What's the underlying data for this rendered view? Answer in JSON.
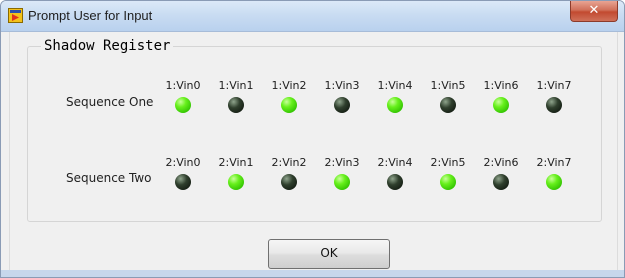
{
  "window": {
    "title": "Prompt User for Input",
    "close_glyph": "✕"
  },
  "group": {
    "title": "Shadow Register"
  },
  "sequences": [
    {
      "label": "Sequence One",
      "leds": [
        {
          "label": "1:Vin0",
          "on": true
        },
        {
          "label": "1:Vin1",
          "on": false
        },
        {
          "label": "1:Vin2",
          "on": true
        },
        {
          "label": "1:Vin3",
          "on": false
        },
        {
          "label": "1:Vin4",
          "on": true
        },
        {
          "label": "1:Vin5",
          "on": false
        },
        {
          "label": "1:Vin6",
          "on": true
        },
        {
          "label": "1:Vin7",
          "on": false
        }
      ]
    },
    {
      "label": "Sequence Two",
      "leds": [
        {
          "label": "2:Vin0",
          "on": false
        },
        {
          "label": "2:Vin1",
          "on": true
        },
        {
          "label": "2:Vin2",
          "on": false
        },
        {
          "label": "2:Vin3",
          "on": true
        },
        {
          "label": "2:Vin4",
          "on": false
        },
        {
          "label": "2:Vin5",
          "on": true
        },
        {
          "label": "2:Vin6",
          "on": false
        },
        {
          "label": "2:Vin7",
          "on": true
        }
      ]
    }
  ],
  "buttons": {
    "ok_label": "OK"
  },
  "colors": {
    "led_on": "#3fdc0a",
    "led_off": "#1b2619",
    "titlebar": "#c9dcf2",
    "close_button": "#c24a30"
  },
  "icons": {
    "app": "labview-app-icon",
    "close": "close-icon"
  }
}
